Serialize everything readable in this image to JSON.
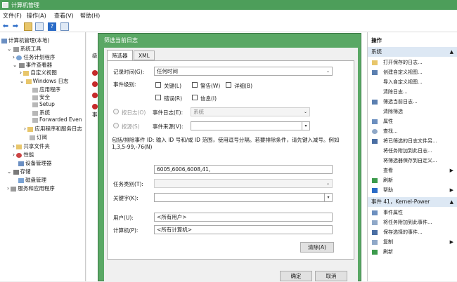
{
  "window": {
    "title": "计算机管理"
  },
  "menu": [
    "文件(F)",
    "操作(A)",
    "查看(V)",
    "帮助(H)"
  ],
  "tree": [
    {
      "label": "计算机管理(本地)"
    },
    {
      "label": "系统工具"
    },
    {
      "label": "任务计划程序"
    },
    {
      "label": "事件查看器"
    },
    {
      "label": "自定义视图"
    },
    {
      "label": "Windows 日志"
    },
    {
      "label": "应用程序"
    },
    {
      "label": "安全"
    },
    {
      "label": "Setup"
    },
    {
      "label": "系统"
    },
    {
      "label": "Forwarded Even"
    },
    {
      "label": "应用程序和服务日志"
    },
    {
      "label": "订阅"
    },
    {
      "label": "共享文件夹"
    },
    {
      "label": "性能"
    },
    {
      "label": "设备管理器"
    },
    {
      "label": "存储"
    },
    {
      "label": "磁盘管理"
    },
    {
      "label": "服务和应用程序"
    }
  ],
  "middle": {
    "col_label": "级",
    "tab_label": "事"
  },
  "dialog": {
    "title": "筛选当前日志",
    "tabs": [
      "筛选器",
      "XML"
    ],
    "logged_label": "记录时间(G):",
    "logged_value": "任何时间",
    "level_label": "事件级别:",
    "levels": [
      "关键(L)",
      "警告(W)",
      "详细(B)",
      "错误(R)",
      "信息(I)"
    ],
    "by_log_label": "按日志(O)",
    "event_logs_label": "事件日志(E):",
    "event_logs_value": "系统",
    "by_source_label": "按源(S)",
    "event_source_label": "事件来源(V):",
    "event_source_value": "",
    "hint": "包括/排除事件 ID: 输入 ID 号和/或 ID 范围，使用逗号分隔。若要排除条件，请先键入减号。例如 1,3,5-99,-76(N)",
    "ids_value": "6005,6006,6008,41,",
    "task_category_label": "任务类别(T):",
    "keywords_label": "关键字(K):",
    "user_label": "用户(U):",
    "user_value": "<所有用户>",
    "computer_label": "计算机(P):",
    "computer_value": "<所有计算机>",
    "clear_btn": "清除(A)",
    "ok_btn": "确定",
    "cancel_btn": "取消"
  },
  "actions": {
    "header": "操作",
    "section1": "系统",
    "items1": [
      "打开保存的日志...",
      "创建自定义视图...",
      "导入自定义视图...",
      "清除日志...",
      "筛选当前日志...",
      "清除筛选",
      "属性",
      "查找...",
      "将已筛选的日志文件另...",
      "将任务附加到此日志...",
      "将筛选器保存到自定义...",
      "查看",
      "刷新",
      "帮助"
    ],
    "section2": "事件 41，Kernel-Power",
    "items2": [
      "事件属性",
      "将任务附加到此事件...",
      "保存选择的事件...",
      "复制",
      "刷新"
    ]
  },
  "colors": {
    "accent": "#4d9e5a",
    "dialog_frame": "#5aa865",
    "selection": "#dde8f4"
  }
}
